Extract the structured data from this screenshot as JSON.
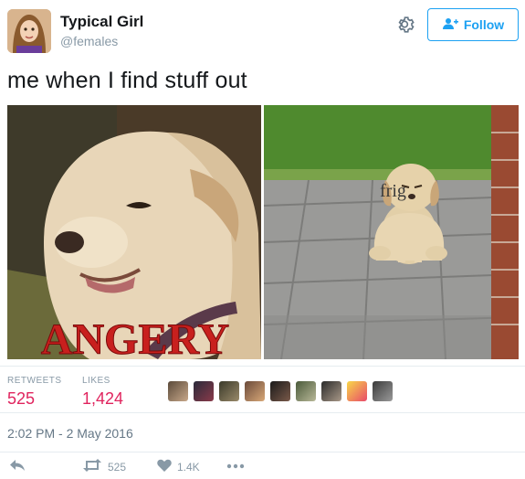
{
  "user": {
    "display_name": "Typical Girl",
    "handle": "@females"
  },
  "header": {
    "settings_icon": "gear-icon",
    "follow_label": "Follow",
    "follow_icon": "add-user-icon"
  },
  "tweet": {
    "text": "me when I find stuff out",
    "media": {
      "left_caption": "ANGERY",
      "right_caption": "frig"
    }
  },
  "stats": {
    "retweets_label": "RETWEETS",
    "retweets_count": "525",
    "likes_label": "LIKES",
    "likes_count": "1,424"
  },
  "timestamp": "2:02 PM - 2 May 2016",
  "actions": {
    "reply_icon": "reply-icon",
    "retweet_icon": "retweet-icon",
    "retweet_count": "525",
    "like_icon": "heart-icon",
    "like_count": "1.4K",
    "more_icon": "more-icon"
  },
  "colors": {
    "accent": "#1da1f2",
    "like": "#e0245e",
    "muted": "#8899a6"
  }
}
